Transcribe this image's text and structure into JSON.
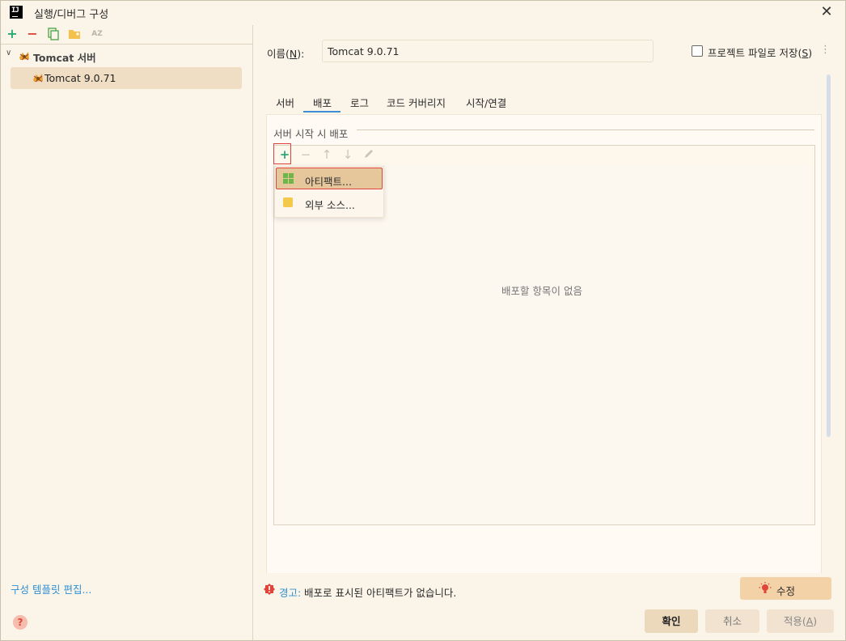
{
  "window": {
    "title": "실행/디버그 구성",
    "close_glyph": "✕"
  },
  "left_toolbar": {
    "add_glyph": "+",
    "remove_glyph": "−",
    "sort_glyph": "AZ"
  },
  "tree": {
    "group_label": "Tomcat 서버",
    "item_label": "Tomcat 9.0.71"
  },
  "edit_templates_link": "구성 템플릿 편집...",
  "help_glyph": "?",
  "name_field": {
    "label": "이름",
    "mnemonic": "N",
    "value": "Tomcat 9.0.71"
  },
  "store_as_project_file": {
    "label": "프로젝트 파일로 저장",
    "mnemonic": "S",
    "checked": false
  },
  "tabs": [
    {
      "label": "서버",
      "active": false
    },
    {
      "label": "배포",
      "active": true
    },
    {
      "label": "로그",
      "active": false
    },
    {
      "label": "코드 커버리지",
      "active": false
    },
    {
      "label": "시작/연결",
      "active": false
    }
  ],
  "deploy": {
    "section_title": "서버 시작 시 배포",
    "add_glyph": "+",
    "remove_glyph": "−",
    "up_glyph": "↑",
    "down_glyph": "↓",
    "empty_text": "배포할 항목이 없음"
  },
  "popup_menu": {
    "items": [
      {
        "label": "아티팩트...",
        "icon": "artifact-icon",
        "selected": true
      },
      {
        "label": "외부 소스...",
        "icon": "external-source-icon",
        "selected": false
      }
    ]
  },
  "warning": {
    "label": "경고:",
    "text": "배포로 표시된 아티팩트가 없습니다.",
    "fix_button": "수정"
  },
  "buttons": {
    "ok": "확인",
    "cancel": "취소",
    "apply": "적용",
    "apply_mnemonic": "A"
  },
  "colors": {
    "background": "#fbf5e9",
    "accent": "#3c8ed6",
    "highlight_border": "#e0433a",
    "selection": "#e6c79c"
  }
}
